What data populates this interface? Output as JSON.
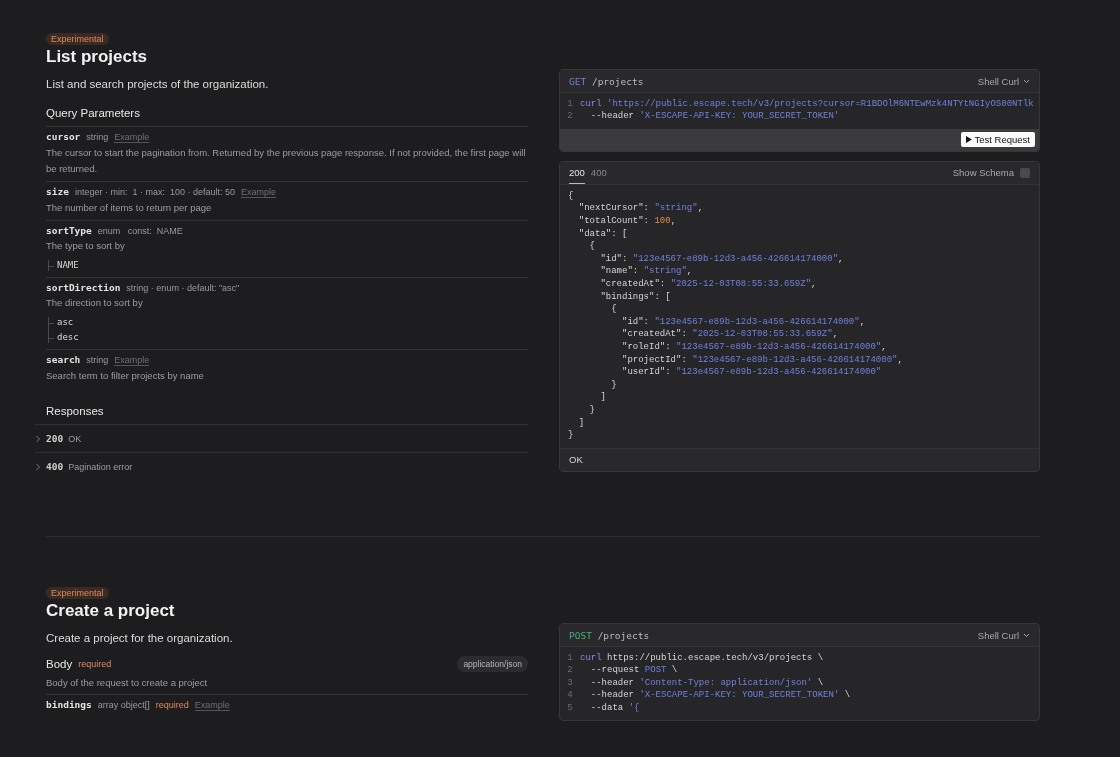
{
  "sections": [
    {
      "badge": "Experimental",
      "title": "List projects",
      "description": "List and search projects of the organization.",
      "params_heading": "Query Parameters",
      "params": [
        {
          "name": "cursor",
          "meta": [
            {
              "kind": "type",
              "text": "string"
            },
            {
              "kind": "example",
              "text": "Example"
            }
          ],
          "description": "The cursor to start the pagination from. Returned by the previous page response. If not provided, the first page will be returned."
        },
        {
          "name": "size",
          "meta": [
            {
              "kind": "type",
              "text": "integer · min:  1 · max:  100 · default: 50"
            },
            {
              "kind": "example",
              "text": "Example"
            }
          ],
          "description": "The number of items to return per page"
        },
        {
          "name": "sortType",
          "meta": [
            {
              "kind": "type",
              "text": "enum   const:  NAME"
            }
          ],
          "description": "The type to sort by",
          "values": [
            "NAME"
          ]
        },
        {
          "name": "sortDirection",
          "meta": [
            {
              "kind": "type",
              "text": "string · enum · default: \"asc\""
            }
          ],
          "description": "The direction to sort by",
          "values": [
            "asc",
            "desc"
          ]
        },
        {
          "name": "search",
          "meta": [
            {
              "kind": "type",
              "text": "string"
            },
            {
              "kind": "example",
              "text": "Example"
            }
          ],
          "description": "Search term to filter projects by name"
        }
      ],
      "responses_heading": "Responses",
      "responses": [
        {
          "code": "200",
          "text": "OK",
          "expanded": false
        },
        {
          "code": "400",
          "text": "Pagination error",
          "expanded": false
        }
      ],
      "request": {
        "kind": "get",
        "method": "GET",
        "path": "/projects",
        "language": "Shell Curl",
        "test_button": "Test Request",
        "code": [
          {
            "num": "1",
            "tokens": [
              {
                "kind": "cmd",
                "text": "curl"
              },
              {
                "kind": "str",
                "text": " 'https://public.escape.tech/v3/projects?cursor=R1BDOlM6NTEwMzk4NTYtNGIyOS00NTlk"
              }
            ]
          },
          {
            "num": "2",
            "tokens": [
              {
                "kind": "plain",
                "text": "  --header "
              },
              {
                "kind": "str",
                "text": "'X-ESCAPE-API-KEY: YOUR_SECRET_TOKEN'"
              }
            ]
          }
        ]
      },
      "response_panel": {
        "tabs": [
          {
            "label": "200",
            "selected": true
          },
          {
            "label": "400",
            "selected": false
          }
        ],
        "schema_toggle": {
          "label": "Show Schema",
          "checked": false
        },
        "status": "OK",
        "body": [
          [
            {
              "kind": "plain",
              "text": "{"
            }
          ],
          [
            {
              "kind": "plain",
              "text": "  \"nextCursor\": "
            },
            {
              "kind": "str",
              "text": "\"string\""
            },
            {
              "kind": "plain",
              "text": ","
            }
          ],
          [
            {
              "kind": "plain",
              "text": "  \"totalCount\": "
            },
            {
              "kind": "num",
              "text": "100"
            },
            {
              "kind": "plain",
              "text": ","
            }
          ],
          [
            {
              "kind": "plain",
              "text": "  \"data\": ["
            }
          ],
          [
            {
              "kind": "plain",
              "text": "    {"
            }
          ],
          [
            {
              "kind": "plain",
              "text": "      \"id\": "
            },
            {
              "kind": "str",
              "text": "\"123e4567-e89b-12d3-a456-426614174000\""
            },
            {
              "kind": "plain",
              "text": ","
            }
          ],
          [
            {
              "kind": "plain",
              "text": "      \"name\": "
            },
            {
              "kind": "str",
              "text": "\"string\""
            },
            {
              "kind": "plain",
              "text": ","
            }
          ],
          [
            {
              "kind": "plain",
              "text": "      \"createdAt\": "
            },
            {
              "kind": "str",
              "text": "\"2025-12-03T08:55:33.659Z\""
            },
            {
              "kind": "plain",
              "text": ","
            }
          ],
          [
            {
              "kind": "plain",
              "text": "      \"bindings\": ["
            }
          ],
          [
            {
              "kind": "plain",
              "text": "        {"
            }
          ],
          [
            {
              "kind": "plain",
              "text": "          \"id\": "
            },
            {
              "kind": "str",
              "text": "\"123e4567-e89b-12d3-a456-426614174000\""
            },
            {
              "kind": "plain",
              "text": ","
            }
          ],
          [
            {
              "kind": "plain",
              "text": "          \"createdAt\": "
            },
            {
              "kind": "str",
              "text": "\"2025-12-03T08:55:33.659Z\""
            },
            {
              "kind": "plain",
              "text": ","
            }
          ],
          [
            {
              "kind": "plain",
              "text": "          \"roleId\": "
            },
            {
              "kind": "str",
              "text": "\"123e4567-e89b-12d3-a456-426614174000\""
            },
            {
              "kind": "plain",
              "text": ","
            }
          ],
          [
            {
              "kind": "plain",
              "text": "          \"projectId\": "
            },
            {
              "kind": "str",
              "text": "\"123e4567-e89b-12d3-a456-426614174000\""
            },
            {
              "kind": "plain",
              "text": ","
            }
          ],
          [
            {
              "kind": "plain",
              "text": "          \"userId\": "
            },
            {
              "kind": "str",
              "text": "\"123e4567-e89b-12d3-a456-426614174000\""
            }
          ],
          [
            {
              "kind": "plain",
              "text": "        }"
            }
          ],
          [
            {
              "kind": "plain",
              "text": "      ]"
            }
          ],
          [
            {
              "kind": "plain",
              "text": "    }"
            }
          ],
          [
            {
              "kind": "plain",
              "text": "  ]"
            }
          ],
          [
            {
              "kind": "plain",
              "text": "}"
            }
          ]
        ]
      }
    },
    {
      "badge": "Experimental",
      "title": "Create a project",
      "description": "Create a project for the organization.",
      "body": {
        "label": "Body",
        "required": "required",
        "content_type": "application/json",
        "description": "Body of the request to create a project"
      },
      "params": [
        {
          "name": "bindings",
          "meta": [
            {
              "kind": "type",
              "text": "array object[]"
            },
            {
              "kind": "required",
              "text": "required"
            },
            {
              "kind": "example",
              "text": "Example"
            }
          ]
        }
      ],
      "request": {
        "kind": "post",
        "method": "POST",
        "path": "/projects",
        "language": "Shell Curl",
        "code": [
          {
            "num": "1",
            "tokens": [
              {
                "kind": "cmd",
                "text": "curl"
              },
              {
                "kind": "plain",
                "text": " https://public.escape.tech/v3/projects \\"
              }
            ]
          },
          {
            "num": "2",
            "tokens": [
              {
                "kind": "plain",
                "text": "  --request "
              },
              {
                "kind": "kw",
                "text": "POST"
              },
              {
                "kind": "plain",
                "text": " \\"
              }
            ]
          },
          {
            "num": "3",
            "tokens": [
              {
                "kind": "plain",
                "text": "  --header "
              },
              {
                "kind": "str",
                "text": "'Content-Type: application/json'"
              },
              {
                "kind": "plain",
                "text": " \\"
              }
            ]
          },
          {
            "num": "4",
            "tokens": [
              {
                "kind": "plain",
                "text": "  --header "
              },
              {
                "kind": "str",
                "text": "'X-ESCAPE-API-KEY: YOUR_SECRET_TOKEN'"
              },
              {
                "kind": "plain",
                "text": " \\"
              }
            ]
          },
          {
            "num": "5",
            "tokens": [
              {
                "kind": "plain",
                "text": "  --data "
              },
              {
                "kind": "str",
                "text": "'{"
              }
            ]
          }
        ]
      }
    }
  ]
}
